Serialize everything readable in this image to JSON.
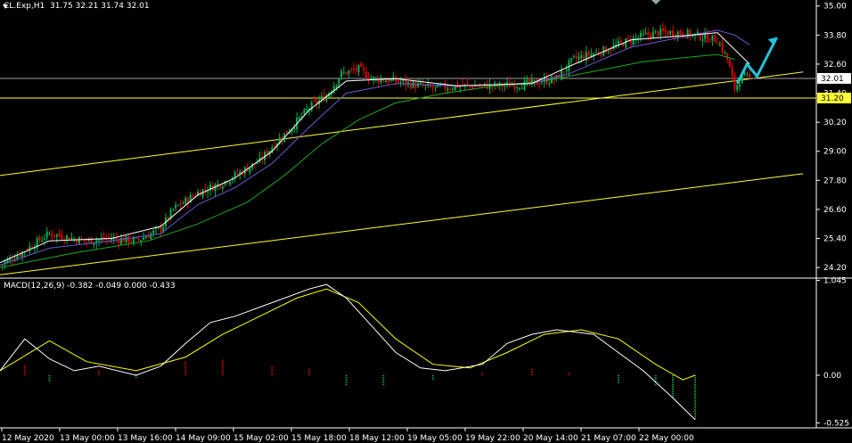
{
  "header": {
    "symbol": "CL.Exp,H1",
    "ohlc": "31.75 32.21 31.74 32.01"
  },
  "macd_header": {
    "label": "MACD(12,26,9) -0.382 -0.049 0.000 -0.433"
  },
  "colors": {
    "background": "#000000",
    "axis": "#ffffff",
    "bull": "#00b050",
    "bear": "#e00000",
    "ma_fast": "#ffffff",
    "ma_mid": "#6a5acd",
    "ma_slow": "#1faa1f",
    "trendline": "#ffff33",
    "hline": "#a0a0a0",
    "arrow": "#22c5dd",
    "macd_line": "#ffffff",
    "signal_line": "#ffff00"
  },
  "chart_data": [
    {
      "type": "line",
      "title": "",
      "price_axis_ticks": [
        "35.00",
        "33.80",
        "32.60",
        "31.40",
        "30.20",
        "29.00",
        "27.80",
        "26.60",
        "25.40",
        "24.20"
      ],
      "ylim": [
        23.8,
        35.1
      ],
      "price_markers": [
        {
          "label": "32.01",
          "value": 32.01
        },
        {
          "label": "31.20",
          "value": 31.2
        }
      ],
      "time_axis_labels": [
        "12 May 2020",
        "13 May 00:00",
        "13 May 16:00",
        "14 May 09:00",
        "15 May 02:00",
        "15 May 18:00",
        "18 May 12:00",
        "19 May 05:00",
        "19 May 22:00",
        "20 May 14:00",
        "21 May 07:00",
        "22 May 00:00"
      ],
      "close_path": [
        [
          0,
          24.3
        ],
        [
          10,
          24.9
        ],
        [
          20,
          25.6
        ],
        [
          25,
          25.5
        ],
        [
          35,
          25.3
        ],
        [
          45,
          25.4
        ],
        [
          55,
          25.3
        ],
        [
          65,
          25.8
        ],
        [
          70,
          26.6
        ],
        [
          80,
          27.3
        ],
        [
          90,
          27.7
        ],
        [
          95,
          28.0
        ],
        [
          105,
          28.6
        ],
        [
          110,
          29.2
        ],
        [
          118,
          30.0
        ],
        [
          125,
          30.8
        ],
        [
          132,
          31.3
        ],
        [
          138,
          32.2
        ],
        [
          145,
          32.4
        ],
        [
          150,
          32.0
        ],
        [
          160,
          31.9
        ],
        [
          175,
          31.6
        ],
        [
          185,
          31.7
        ],
        [
          200,
          31.7
        ],
        [
          215,
          31.8
        ],
        [
          225,
          32.0
        ],
        [
          232,
          32.8
        ],
        [
          245,
          33.2
        ],
        [
          255,
          33.6
        ],
        [
          265,
          33.9
        ],
        [
          275,
          33.9
        ],
        [
          285,
          33.7
        ],
        [
          290,
          33.6
        ],
        [
          294,
          32.8
        ],
        [
          297,
          31.6
        ],
        [
          300,
          32.1
        ],
        [
          303,
          32.0
        ]
      ],
      "ma_fast_path": [
        [
          0,
          24.4
        ],
        [
          20,
          25.3
        ],
        [
          45,
          25.4
        ],
        [
          65,
          25.9
        ],
        [
          80,
          27.2
        ],
        [
          95,
          27.9
        ],
        [
          110,
          29.0
        ],
        [
          125,
          30.7
        ],
        [
          140,
          31.9
        ],
        [
          160,
          32.0
        ],
        [
          185,
          31.7
        ],
        [
          215,
          31.8
        ],
        [
          230,
          32.5
        ],
        [
          255,
          33.6
        ],
        [
          280,
          33.8
        ],
        [
          290,
          33.9
        ],
        [
          297,
          33.2
        ],
        [
          303,
          32.6
        ]
      ],
      "ma_mid_path": [
        [
          0,
          24.3
        ],
        [
          20,
          25.0
        ],
        [
          45,
          25.3
        ],
        [
          65,
          25.6
        ],
        [
          80,
          26.8
        ],
        [
          95,
          27.5
        ],
        [
          110,
          28.5
        ],
        [
          125,
          30.0
        ],
        [
          140,
          31.4
        ],
        [
          160,
          31.8
        ],
        [
          185,
          31.7
        ],
        [
          215,
          31.8
        ],
        [
          230,
          32.2
        ],
        [
          255,
          33.3
        ],
        [
          280,
          33.8
        ],
        [
          290,
          34.0
        ],
        [
          297,
          33.8
        ],
        [
          303,
          33.4
        ]
      ],
      "ma_slow_path": [
        [
          0,
          24.2
        ],
        [
          30,
          24.8
        ],
        [
          60,
          25.3
        ],
        [
          80,
          26.0
        ],
        [
          100,
          26.9
        ],
        [
          115,
          28.0
        ],
        [
          130,
          29.3
        ],
        [
          145,
          30.3
        ],
        [
          160,
          31.0
        ],
        [
          180,
          31.4
        ],
        [
          200,
          31.7
        ],
        [
          220,
          31.9
        ],
        [
          240,
          32.3
        ],
        [
          260,
          32.7
        ],
        [
          280,
          32.9
        ],
        [
          290,
          33.0
        ],
        [
          297,
          32.8
        ]
      ],
      "trendlines": [
        {
          "from": [
            0,
            28.0
          ],
          "to": [
            303,
            32.2
          ]
        },
        {
          "from": [
            0,
            23.9
          ],
          "to": [
            303,
            28.0
          ]
        }
      ],
      "projection_arrow": [
        [
          298,
          31.8
        ],
        [
          302,
          32.6
        ],
        [
          306,
          32.1
        ],
        [
          314,
          33.7
        ]
      ]
    },
    {
      "type": "bar",
      "title": "MACD(12,26,9)",
      "axis_ticks": [
        "1.045",
        "0.00",
        "-0.525"
      ],
      "ylim": [
        -0.56,
        1.06
      ],
      "macd_path": [
        [
          0,
          0.05
        ],
        [
          10,
          0.4
        ],
        [
          20,
          0.18
        ],
        [
          30,
          0.05
        ],
        [
          40,
          0.1
        ],
        [
          55,
          0.0
        ],
        [
          65,
          0.1
        ],
        [
          75,
          0.35
        ],
        [
          85,
          0.58
        ],
        [
          95,
          0.65
        ],
        [
          110,
          0.8
        ],
        [
          125,
          0.95
        ],
        [
          132,
          1.0
        ],
        [
          140,
          0.85
        ],
        [
          150,
          0.55
        ],
        [
          160,
          0.25
        ],
        [
          170,
          0.08
        ],
        [
          180,
          0.05
        ],
        [
          195,
          0.12
        ],
        [
          205,
          0.35
        ],
        [
          215,
          0.45
        ],
        [
          225,
          0.5
        ],
        [
          240,
          0.45
        ],
        [
          250,
          0.25
        ],
        [
          260,
          0.05
        ],
        [
          272,
          -0.25
        ],
        [
          281,
          -0.49
        ]
      ],
      "signal_path": [
        [
          0,
          0.05
        ],
        [
          20,
          0.38
        ],
        [
          35,
          0.15
        ],
        [
          55,
          0.05
        ],
        [
          75,
          0.2
        ],
        [
          90,
          0.45
        ],
        [
          105,
          0.65
        ],
        [
          120,
          0.85
        ],
        [
          132,
          0.95
        ],
        [
          145,
          0.8
        ],
        [
          160,
          0.4
        ],
        [
          175,
          0.12
        ],
        [
          190,
          0.08
        ],
        [
          205,
          0.25
        ],
        [
          220,
          0.45
        ],
        [
          235,
          0.5
        ],
        [
          250,
          0.4
        ],
        [
          265,
          0.12
        ],
        [
          276,
          -0.05
        ],
        [
          281,
          0.0
        ]
      ],
      "histogram": [
        {
          "x": 10,
          "v": 0.12
        },
        {
          "x": 20,
          "v": -0.08
        },
        {
          "x": 40,
          "v": 0.05
        },
        {
          "x": 55,
          "v": -0.04
        },
        {
          "x": 75,
          "v": 0.15
        },
        {
          "x": 90,
          "v": 0.18
        },
        {
          "x": 110,
          "v": 0.1
        },
        {
          "x": 125,
          "v": 0.08
        },
        {
          "x": 140,
          "v": -0.12
        },
        {
          "x": 155,
          "v": -0.12
        },
        {
          "x": 175,
          "v": -0.05
        },
        {
          "x": 195,
          "v": 0.04
        },
        {
          "x": 215,
          "v": 0.08
        },
        {
          "x": 230,
          "v": 0.03
        },
        {
          "x": 250,
          "v": -0.1
        },
        {
          "x": 265,
          "v": -0.12
        },
        {
          "x": 272,
          "v": -0.25
        },
        {
          "x": 281,
          "v": -0.49
        }
      ]
    }
  ]
}
